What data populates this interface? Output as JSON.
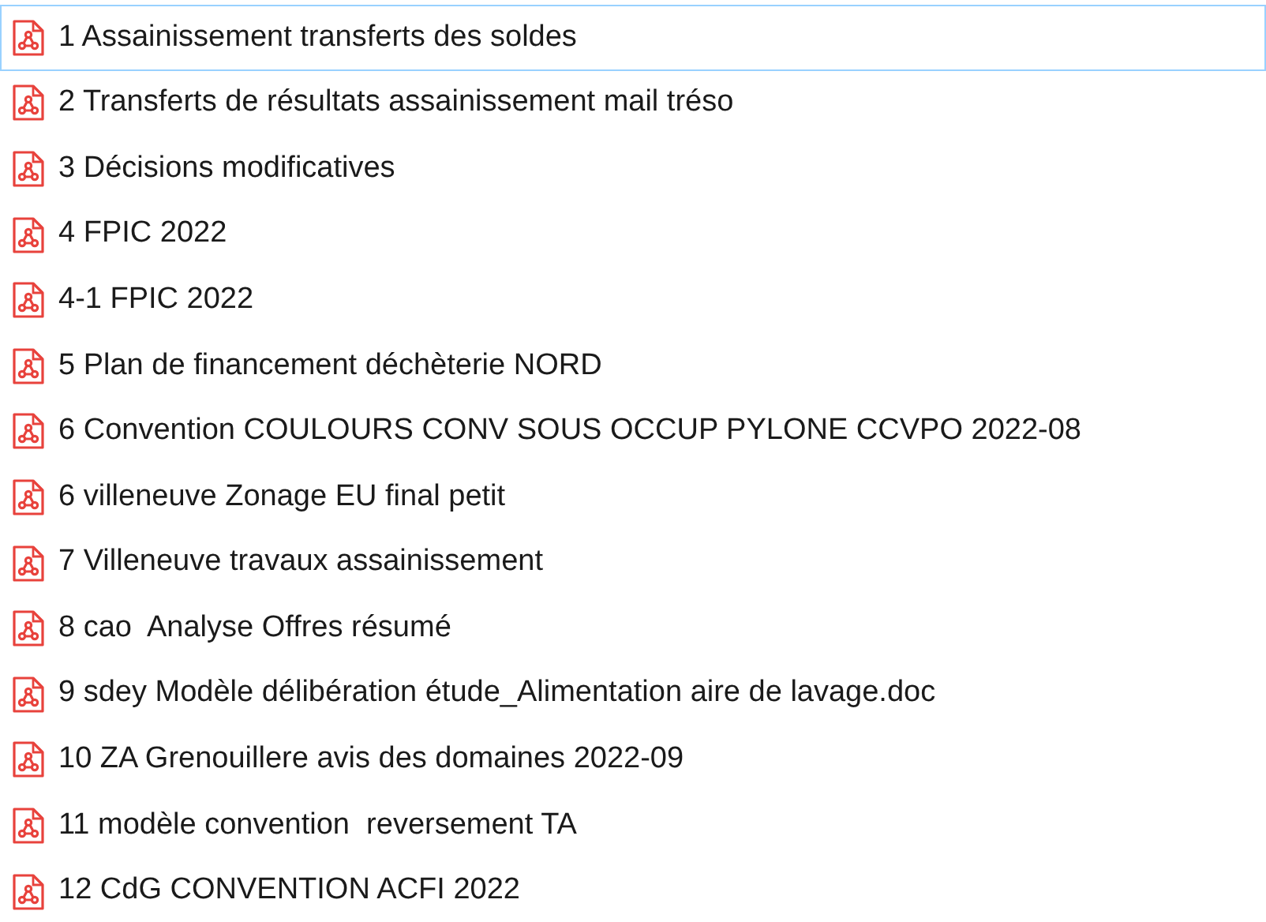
{
  "files": [
    {
      "name": "1 Assainissement transferts des soldes",
      "selected": true
    },
    {
      "name": "2 Transferts de résultats assainissement mail tréso",
      "selected": false
    },
    {
      "name": "3 Décisions modificatives",
      "selected": false
    },
    {
      "name": "4 FPIC 2022",
      "selected": false
    },
    {
      "name": "4-1 FPIC 2022",
      "selected": false
    },
    {
      "name": "5 Plan de financement déchèterie NORD",
      "selected": false
    },
    {
      "name": "6 Convention COULOURS CONV SOUS OCCUP PYLONE CCVPO 2022-08",
      "selected": false
    },
    {
      "name": "6 villeneuve Zonage EU final petit",
      "selected": false
    },
    {
      "name": "7 Villeneuve travaux assainissement",
      "selected": false
    },
    {
      "name": "8 cao  Analyse Offres résumé",
      "selected": false
    },
    {
      "name": "9 sdey Modèle délibération étude_Alimentation aire de lavage.doc",
      "selected": false
    },
    {
      "name": "10 ZA Grenouillere avis des domaines 2022-09",
      "selected": false
    },
    {
      "name": "11 modèle convention  reversement TA",
      "selected": false
    },
    {
      "name": "12 CdG CONVENTION ACFI 2022",
      "selected": false
    }
  ]
}
